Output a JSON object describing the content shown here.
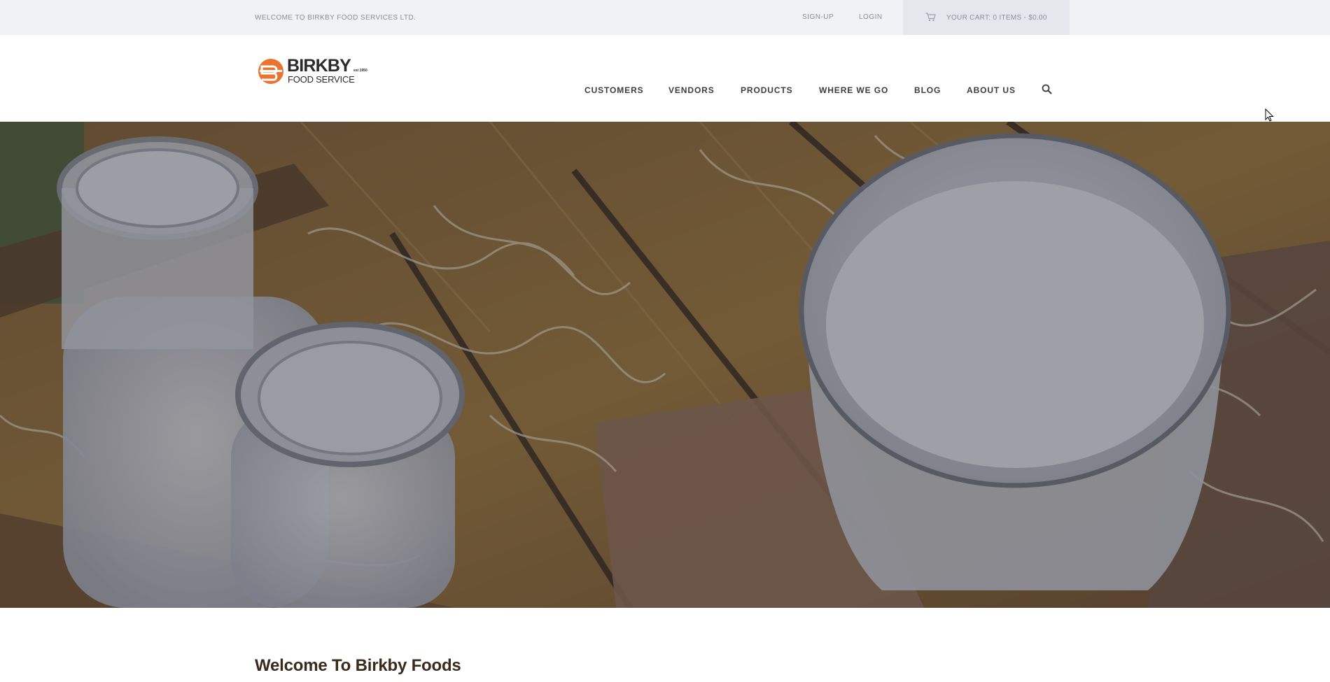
{
  "topbar": {
    "welcome": "WELCOME TO BIRKBY FOOD SERVICES LTD.",
    "signup": "SIGN-UP",
    "login": "LOGIN",
    "cart": "YOUR CART: 0 ITEMS - $0.00",
    "cart_icon": "cart-icon"
  },
  "logo": {
    "name": "BIRKBY",
    "est": "est 1950",
    "sub": "FOOD SERVICE",
    "accent": "#e8742f"
  },
  "nav": {
    "items": [
      "CUSTOMERS",
      "VENDORS",
      "PRODUCTS",
      "WHERE WE GO",
      "BLOG",
      "ABOUT US"
    ],
    "search_icon": "search-icon"
  },
  "main": {
    "heading": "Welcome To Birkby Foods"
  },
  "colors": {
    "topbar_bg": "#f0f3f6",
    "cart_bg": "#e4e8ec",
    "heading": "#3a2a1c",
    "nav_text": "#3a3d42"
  }
}
